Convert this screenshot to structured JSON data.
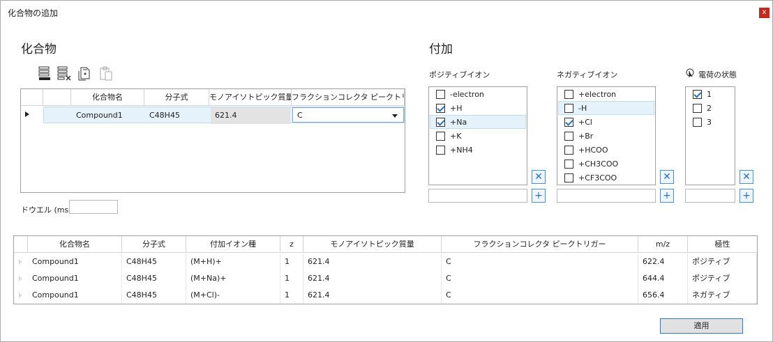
{
  "window": {
    "title": "化合物の追加",
    "close_glyph": "x"
  },
  "compound_section": {
    "heading": "化合物",
    "table": {
      "headers": [
        "化合物名",
        "分子式",
        "モノアイソトピック質量",
        "フラクションコレクタ ピークトリガー"
      ],
      "rows": [
        {
          "name": "Compound1",
          "formula": "C48H45",
          "mass": "621.4",
          "trigger": "C"
        }
      ]
    },
    "dwell_label": "ドウエル (ms)",
    "dwell_value": ""
  },
  "adduct_section": {
    "heading": "付加",
    "positive": {
      "label": "ポジティブイオン",
      "items": [
        {
          "label": "-electron",
          "checked": false
        },
        {
          "label": "+H",
          "checked": true
        },
        {
          "label": "+Na",
          "checked": true,
          "selected": true
        },
        {
          "label": "+K",
          "checked": false
        },
        {
          "label": "+NH4",
          "checked": false
        }
      ]
    },
    "negative": {
      "label": "ネガティブイオン",
      "items": [
        {
          "label": "+electron",
          "checked": false
        },
        {
          "label": "-H",
          "checked": false,
          "selected": true
        },
        {
          "label": "+Cl",
          "checked": true
        },
        {
          "label": "+Br",
          "checked": false
        },
        {
          "label": "+HCOO",
          "checked": false
        },
        {
          "label": "+CH3COO",
          "checked": false
        },
        {
          "label": "+CF3COO",
          "checked": false
        }
      ]
    },
    "charge": {
      "label": "電荷の状態",
      "items": [
        {
          "label": "1",
          "checked": true
        },
        {
          "label": "2",
          "checked": false
        },
        {
          "label": "3",
          "checked": false
        }
      ]
    },
    "remove_glyph": "✕",
    "add_glyph": "+"
  },
  "result_table": {
    "headers": [
      "化合物名",
      "分子式",
      "付加イオン種",
      "z",
      "モノアイソトピック質量",
      "フラクションコレクタ ピークトリガー",
      "m/z",
      "極性"
    ],
    "rows": [
      [
        "Compound1",
        "C48H45",
        "(M+H)+",
        "1",
        "621.4",
        "C",
        "622.4",
        "ポジティブ"
      ],
      [
        "Compound1",
        "C48H45",
        "(M+Na)+",
        "1",
        "621.4",
        "C",
        "644.4",
        "ポジティブ"
      ],
      [
        "Compound1",
        "C48H45",
        "(M+Cl)-",
        "1",
        "621.4",
        "C",
        "656.4",
        "ネガティブ"
      ]
    ]
  },
  "apply_label": "適用"
}
